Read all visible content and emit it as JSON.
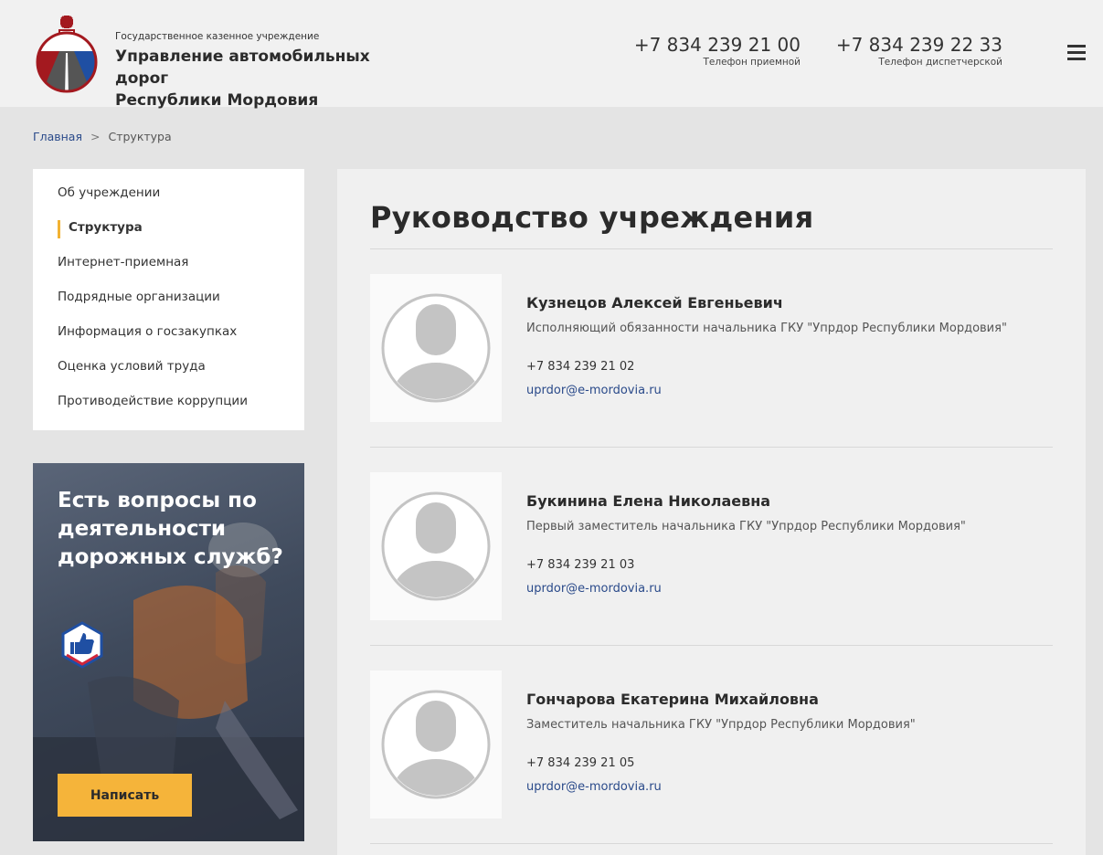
{
  "header": {
    "org_subtitle": "Государственное казенное учреждение",
    "org_name_line1": "Управление автомобильных дорог",
    "org_name_line2": "Республики Мордовия",
    "phones": [
      {
        "number": "+7 834 239 21 00",
        "caption": "Телефон приемной"
      },
      {
        "number": "+7 834 239 22 33",
        "caption": "Телефон диспетчерской"
      }
    ],
    "menu_icon": "hamburger-menu-icon",
    "logo_icon": "mordovia-road-emblem"
  },
  "breadcrumb": {
    "home": "Главная",
    "separator": ">",
    "current": "Структура"
  },
  "sidebar": {
    "items": [
      {
        "label": "Об учреждении"
      },
      {
        "label": "Структура",
        "active": true
      },
      {
        "label": "Интернет-приемная"
      },
      {
        "label": "Подрядные организации"
      },
      {
        "label": "Информация о госзакупках"
      },
      {
        "label": "Оценка условий труда"
      },
      {
        "label": "Противодействие коррупции"
      }
    ]
  },
  "promo": {
    "title": "Есть вопросы по деятельности дорожных служб?",
    "button_label": "Написать",
    "badge_icon": "thumbs-up-icon"
  },
  "main": {
    "title": "Руководство учреждения",
    "people": [
      {
        "name": "Кузнецов Алексей Евгеньевич",
        "position": "Исполняющий обязанности начальника ГКУ \"Упрдор Республики Мордовия\"",
        "phone": "+7 834 239 21 02",
        "email": "uprdor@e-mordovia.ru"
      },
      {
        "name": "Букинина Елена Николаевна",
        "position": "Первый заместитель начальника ГКУ \"Упрдор Республики Мордовия\"",
        "phone": "+7 834 239 21 03",
        "email": "uprdor@e-mordovia.ru"
      },
      {
        "name": "Гончарова Екатерина Михайловна",
        "position": "Заместитель начальника ГКУ \"Упрдор Республики Мордовия\"",
        "phone": "+7 834 239 21 05",
        "email": "uprdor@e-mordovia.ru"
      }
    ]
  },
  "colors": {
    "accent": "#f5b43a",
    "link": "#2a4a8a",
    "logo_red": "#a3191f",
    "logo_blue": "#1f4fa3"
  }
}
